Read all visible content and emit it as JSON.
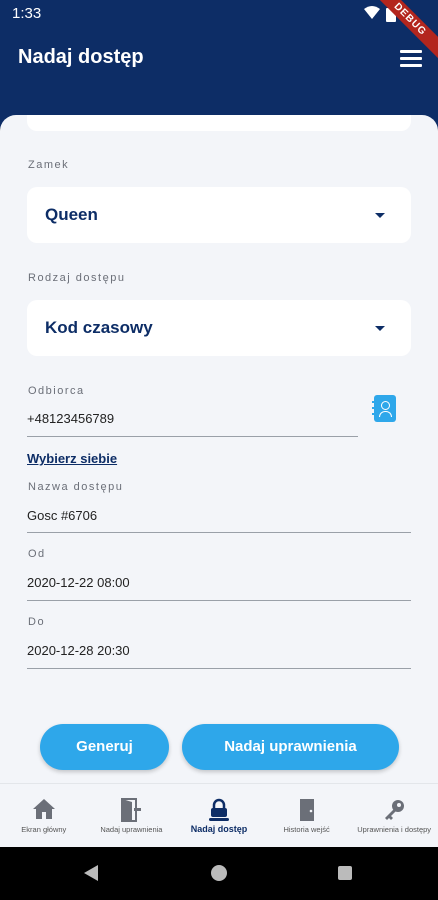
{
  "status_bar": {
    "time": "1:33",
    "debug_label": "DEBUG"
  },
  "app_bar": {
    "title": "Nadaj dostęp"
  },
  "form": {
    "lock_label": "Zamek",
    "lock_value": "Queen",
    "access_type_label": "Rodzaj dostępu",
    "access_type_value": "Kod czasowy",
    "recipient_label": "Odbiorca",
    "recipient_value": "+48123456789",
    "choose_self_link": "Wybierz siebie",
    "access_name_label": "Nazwa dostępu",
    "access_name_value": "Gosc #6706",
    "from_label": "Od",
    "from_value": "2020-12-22 08:00",
    "to_label": "Do",
    "to_value": "2020-12-28 20:30"
  },
  "buttons": {
    "generate": "Generuj",
    "grant": "Nadaj uprawnienia"
  },
  "bottom_nav": {
    "items": [
      {
        "label": "Ekran główny",
        "icon": "home-icon"
      },
      {
        "label": "Nadaj uprawnienia",
        "icon": "door-open-icon"
      },
      {
        "label": "Nadaj dostęp",
        "icon": "lock-icon"
      },
      {
        "label": "Historia wejść",
        "icon": "door-icon"
      },
      {
        "label": "Uprawnienia i dostępy",
        "icon": "key-icon"
      }
    ],
    "active_index": 2
  },
  "colors": {
    "primary": "#0d2d66",
    "accent": "#2ea7ea",
    "background": "#f3f5f9"
  }
}
